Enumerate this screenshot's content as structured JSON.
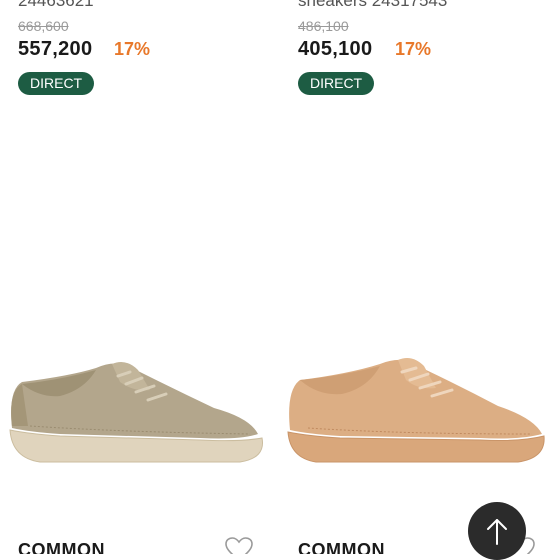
{
  "products": [
    {
      "name_cut": "24463621",
      "original_price": "668,600",
      "price": "557,200",
      "discount": "17%",
      "badge": "DIRECT",
      "brand": "COMMON",
      "image_icon": "beige-suede-sneaker"
    },
    {
      "name_cut": "sneakers 24317543",
      "original_price": "486,100",
      "price": "405,100",
      "discount": "17%",
      "badge": "DIRECT",
      "brand": "COMMON",
      "image_icon": "tan-leather-sneaker"
    }
  ],
  "colors": {
    "discount": "#e8782a",
    "badge_bg": "#1d5c43",
    "top_button_bg": "#2b2b2b"
  },
  "icons": {
    "wishlist": "heart-outline-icon",
    "scroll_top": "arrow-up-icon"
  }
}
